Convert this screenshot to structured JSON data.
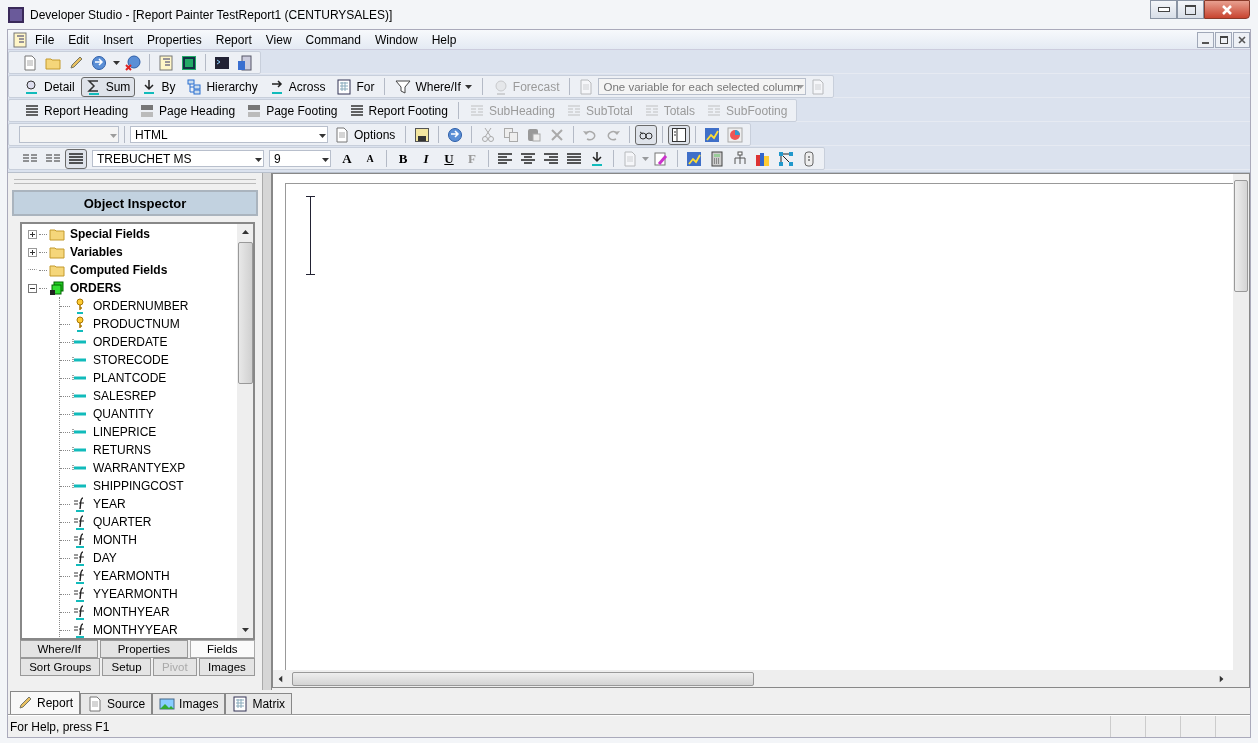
{
  "window": {
    "title": "Developer Studio - [Report Painter TestReport1 (CENTURYSALES)]"
  },
  "menu": [
    "File",
    "Edit",
    "Insert",
    "Properties",
    "Report",
    "View",
    "Command",
    "Window",
    "Help"
  ],
  "report_toolbar": [
    {
      "label": "Detail",
      "kind": "button",
      "selected": false,
      "disabled": false
    },
    {
      "label": "Sum",
      "kind": "button",
      "selected": true,
      "disabled": false
    },
    {
      "label": "By",
      "kind": "button",
      "selected": false,
      "disabled": false
    },
    {
      "label": "Hierarchy",
      "kind": "button",
      "selected": false,
      "disabled": false
    },
    {
      "label": "Across",
      "kind": "button",
      "selected": false,
      "disabled": false
    },
    {
      "label": "For",
      "kind": "button",
      "selected": false,
      "disabled": false
    },
    {
      "label": "Where/If",
      "kind": "menu",
      "selected": false,
      "disabled": false
    },
    {
      "label": "Forecast",
      "kind": "button",
      "selected": false,
      "disabled": true
    }
  ],
  "variable_select": {
    "value": "One variable for each selected column",
    "disabled": true
  },
  "section_toolbar": [
    {
      "label": "Report Heading",
      "disabled": false
    },
    {
      "label": "Page Heading",
      "disabled": false
    },
    {
      "label": "Page Footing",
      "disabled": false
    },
    {
      "label": "Report Footing",
      "disabled": false
    },
    {
      "label": "SubHeading",
      "disabled": true
    },
    {
      "label": "SubTotal",
      "disabled": true
    },
    {
      "label": "Totals",
      "disabled": true
    },
    {
      "label": "SubFooting",
      "disabled": true
    }
  ],
  "format_select": {
    "value": "HTML"
  },
  "options_button": {
    "label": "Options"
  },
  "font_select": {
    "value": "TREBUCHET MS"
  },
  "size_select": {
    "value": "9"
  },
  "size_buttons": [
    "A",
    "A"
  ],
  "style_buttons": [
    "B",
    "I",
    "U",
    "F"
  ],
  "inspector": {
    "title": "Object Inspector",
    "tree": [
      {
        "label": "Special Fields",
        "kind": "folder",
        "expandable": true,
        "expanded": false
      },
      {
        "label": "Variables",
        "kind": "folder",
        "expandable": true,
        "expanded": false
      },
      {
        "label": "Computed Fields",
        "kind": "folder",
        "expandable": false
      },
      {
        "label": "ORDERS",
        "kind": "table",
        "expandable": true,
        "expanded": true,
        "children": [
          {
            "label": "ORDERNUMBER",
            "kind": "key"
          },
          {
            "label": "PRODUCTNUM",
            "kind": "key"
          },
          {
            "label": "ORDERDATE",
            "kind": "field"
          },
          {
            "label": "STORECODE",
            "kind": "field"
          },
          {
            "label": "PLANTCODE",
            "kind": "field"
          },
          {
            "label": "SALESREP",
            "kind": "field"
          },
          {
            "label": "QUANTITY",
            "kind": "field"
          },
          {
            "label": "LINEPRICE",
            "kind": "field"
          },
          {
            "label": "RETURNS",
            "kind": "field"
          },
          {
            "label": "WARRANTYEXP",
            "kind": "field"
          },
          {
            "label": "SHIPPINGCOST",
            "kind": "field"
          },
          {
            "label": "YEAR",
            "kind": "computed"
          },
          {
            "label": "QUARTER",
            "kind": "computed"
          },
          {
            "label": "MONTH",
            "kind": "computed"
          },
          {
            "label": "DAY",
            "kind": "computed"
          },
          {
            "label": "YEARMONTH",
            "kind": "computed"
          },
          {
            "label": "YYEARMONTH",
            "kind": "computed"
          },
          {
            "label": "MONTHYEAR",
            "kind": "computed"
          },
          {
            "label": "MONTHYYEAR",
            "kind": "computed"
          }
        ]
      }
    ],
    "tabs_row1": [
      {
        "label": "Where/If",
        "selected": false,
        "disabled": false
      },
      {
        "label": "Properties",
        "selected": false,
        "disabled": false
      },
      {
        "label": "Fields",
        "selected": true,
        "disabled": false
      }
    ],
    "tabs_row2": [
      {
        "label": "Sort Groups",
        "selected": false,
        "disabled": false
      },
      {
        "label": "Setup",
        "selected": false,
        "disabled": false
      },
      {
        "label": "Pivot",
        "selected": false,
        "disabled": true
      },
      {
        "label": "Images",
        "selected": false,
        "disabled": false
      }
    ]
  },
  "document_tabs": [
    {
      "label": "Report",
      "selected": true
    },
    {
      "label": "Source",
      "selected": false
    },
    {
      "label": "Images",
      "selected": false
    },
    {
      "label": "Matrix",
      "selected": false
    }
  ],
  "status_bar": "For Help, press F1"
}
